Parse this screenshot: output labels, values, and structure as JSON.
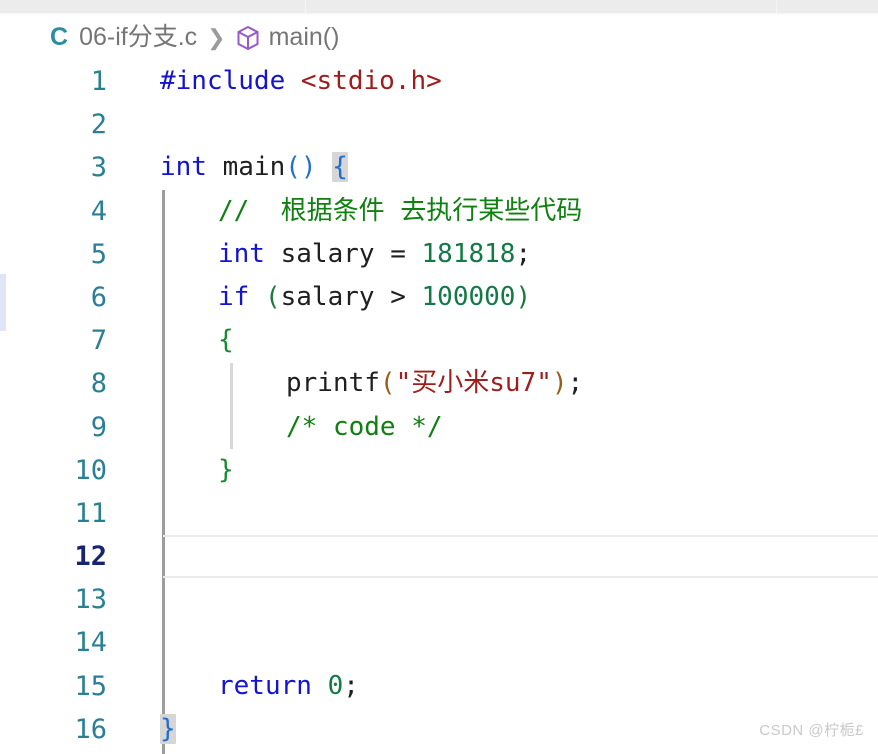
{
  "window": {
    "tab_strip": {
      "segments": 3,
      "bg": "#ececec"
    }
  },
  "breadcrumb": {
    "language_badge": "C",
    "file_name": "06-if分支.c",
    "separator": "❯",
    "symbol_icon": "cube-icon",
    "symbol_name": "main()",
    "file_color": "#757575",
    "badge_color": "#2d8ca5",
    "symbol_icon_color": "#9a59c9"
  },
  "editor": {
    "active_line": 12,
    "total_lines": 16,
    "line_number_color": "#2a7f95",
    "active_line_number_color": "#17256e",
    "lines": [
      {
        "n": "1",
        "indent": 0,
        "text": "#include <stdio.h>"
      },
      {
        "n": "2",
        "indent": 0,
        "text": ""
      },
      {
        "n": "3",
        "indent": 0,
        "text": "int main() {"
      },
      {
        "n": "4",
        "indent": 1,
        "text": "//  根据条件 去执行某些代码"
      },
      {
        "n": "5",
        "indent": 1,
        "text": "int salary = 181818;"
      },
      {
        "n": "6",
        "indent": 1,
        "text": "if (salary > 100000)"
      },
      {
        "n": "7",
        "indent": 1,
        "text": "{"
      },
      {
        "n": "8",
        "indent": 2,
        "text": "printf(\"买小米su7\");"
      },
      {
        "n": "9",
        "indent": 2,
        "text": "/* code */"
      },
      {
        "n": "10",
        "indent": 1,
        "text": "}"
      },
      {
        "n": "11",
        "indent": 0,
        "text": ""
      },
      {
        "n": "12",
        "indent": 0,
        "text": ""
      },
      {
        "n": "13",
        "indent": 0,
        "text": ""
      },
      {
        "n": "14",
        "indent": 0,
        "text": ""
      },
      {
        "n": "15",
        "indent": 1,
        "text": "return 0;"
      },
      {
        "n": "16",
        "indent": 0,
        "text": "}"
      }
    ],
    "tokens": {
      "include_directive": "#include",
      "header_name": "<stdio.h>",
      "kw_int": "int",
      "kw_if": "if",
      "kw_return": "return",
      "fn_main": "main",
      "fn_printf": "printf",
      "var_salary": "salary",
      "num_salary_value": "181818",
      "num_threshold": "100000",
      "num_zero": "0",
      "op_assign": "=",
      "op_gt": ">",
      "string_literal": "\"买小米su7\"",
      "line_comment": "//  根据条件 去执行某些代码",
      "block_comment": "/* code */",
      "brace_open": "{",
      "brace_close": "}",
      "paren_open": "(",
      "paren_close": ")",
      "semicolon": ";"
    },
    "colors": {
      "keyword": "#1313d1",
      "number": "#127a46",
      "string": "#a01d1d",
      "comment": "#108010",
      "header": "#a01d1d",
      "identifier": "#1f1f1f",
      "brace_green": "#158a2f",
      "brace_blue": "#1f6fd0",
      "bracket_match_bg": "#d6d6d6",
      "indent_guide_active": "#9d9d9d",
      "indent_guide": "#d8d8d8",
      "current_line_border": "#eaeaea",
      "left_marker": "#dfe4f7"
    }
  },
  "watermark": {
    "text": "CSDN @柠栀£",
    "color": "#c9c9c9"
  }
}
